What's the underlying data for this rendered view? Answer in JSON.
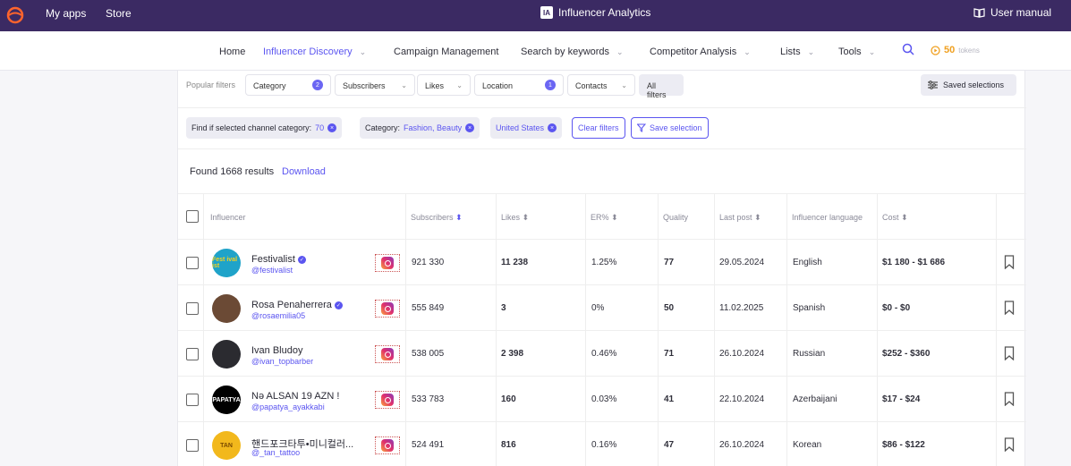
{
  "topbar": {
    "my_apps": "My apps",
    "store": "Store",
    "title": "Influencer Analytics",
    "user_manual": "User manual"
  },
  "subnav": {
    "items": [
      "Home",
      "Influencer Discovery",
      "Campaign Management",
      "Search by keywords",
      "Competitor Analysis",
      "Lists",
      "Tools"
    ],
    "tokens_count": "50",
    "tokens_label": "tokens"
  },
  "filters": {
    "popular_label": "Popular filters",
    "category": "Category",
    "category_count": "2",
    "subscribers": "Subscribers",
    "likes": "Likes",
    "location": "Location",
    "location_count": "1",
    "contacts": "Contacts",
    "all_filters": "All filters",
    "saved_selections": "Saved selections"
  },
  "chips": {
    "find_label": "Find if selected channel category:",
    "find_value": "70",
    "category_label": "Category:",
    "category_value": "Fashion, Beauty",
    "location_value": "United States",
    "clear_filters": "Clear filters",
    "save_selection": "Save selection"
  },
  "results": {
    "found": "Found 1668 results",
    "download": "Download"
  },
  "table": {
    "headers": [
      "Influencer",
      "Subscribers",
      "Likes",
      "ER%",
      "Quality",
      "Last post",
      "Influencer language",
      "Cost"
    ],
    "rows": [
      {
        "name": "Festivalist",
        "handle": "@festivalist",
        "verified": true,
        "avatar_text": "Fest ival ist",
        "avatar_bg": "#1fa3c9",
        "avatar_fg": "#f7d21e",
        "subscribers": "921 330",
        "likes": "11 238",
        "er": "1.25%",
        "quality": "77",
        "last_post": "29.05.2024",
        "language": "English",
        "cost": "$1 180 - $1 686"
      },
      {
        "name": "Rosa Penaherrera",
        "handle": "@rosaemilia05",
        "verified": true,
        "avatar_text": "",
        "avatar_bg": "#6b4a35",
        "avatar_fg": "#fff",
        "subscribers": "555 849",
        "likes": "3",
        "er": "0%",
        "quality": "50",
        "last_post": "11.02.2025",
        "language": "Spanish",
        "cost": "$0 - $0"
      },
      {
        "name": "Ivan Bludoy",
        "handle": "@ivan_topbarber",
        "verified": false,
        "avatar_text": "",
        "avatar_bg": "#2b2b30",
        "avatar_fg": "#fff",
        "subscribers": "538 005",
        "likes": "2 398",
        "er": "0.46%",
        "quality": "71",
        "last_post": "26.10.2024",
        "language": "Russian",
        "cost": "$252 - $360"
      },
      {
        "name": "Nə ALSAN 19 AZN !",
        "handle": "@papatya_ayakkabi",
        "verified": false,
        "avatar_text": "PAPATYA",
        "avatar_bg": "#000000",
        "avatar_fg": "#fff",
        "subscribers": "533 783",
        "likes": "160",
        "er": "0.03%",
        "quality": "41",
        "last_post": "22.10.2024",
        "language": "Azerbaijani",
        "cost": "$17 - $24"
      },
      {
        "name": "핸드포크타투•미니컬러...",
        "handle": "@_tan_tattoo",
        "verified": false,
        "avatar_text": "TAN",
        "avatar_bg": "#f2b81c",
        "avatar_fg": "#7a4a00",
        "subscribers": "524 491",
        "likes": "816",
        "er": "0.16%",
        "quality": "47",
        "last_post": "26.10.2024",
        "language": "Korean",
        "cost": "$86 - $122"
      }
    ]
  },
  "colors": {
    "accent": "#5b55f0",
    "topbar": "#3b2a63"
  }
}
